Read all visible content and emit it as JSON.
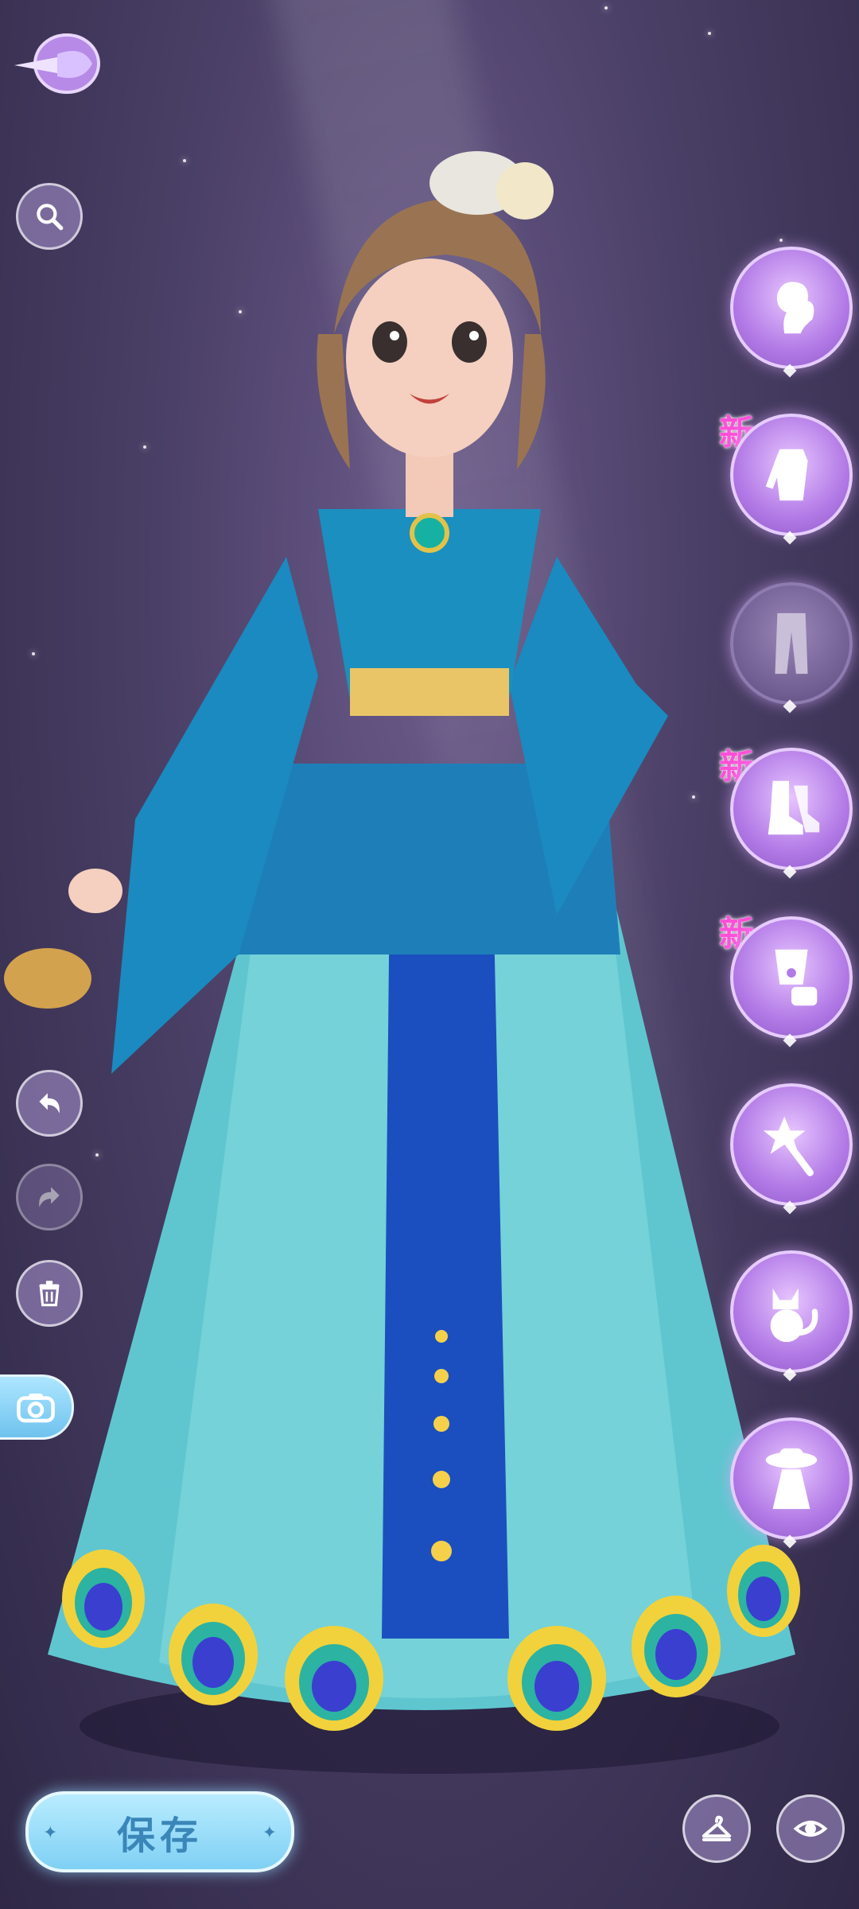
{
  "toolbar": {
    "back_icon": "back-quill-icon",
    "search_icon": "search-icon",
    "undo_icon": "undo-icon",
    "redo_icon": "redo-icon",
    "trash_icon": "trash-icon",
    "camera_icon": "camera-icon"
  },
  "categories": [
    {
      "icon": "hairstyle-icon",
      "new": false,
      "active": true
    },
    {
      "icon": "top-icon",
      "new": true,
      "badge": "新",
      "active": true
    },
    {
      "icon": "bottom-icon",
      "new": false,
      "active": false
    },
    {
      "icon": "shoes-icon",
      "new": true,
      "badge": "新",
      "active": true
    },
    {
      "icon": "accessory-icon",
      "new": true,
      "badge": "新",
      "active": true
    },
    {
      "icon": "magic-wand-icon",
      "new": false,
      "active": true
    },
    {
      "icon": "pet-cat-icon",
      "new": false,
      "active": true
    },
    {
      "icon": "full-outfit-icon",
      "new": false,
      "active": true
    }
  ],
  "bottom": {
    "save_label": "保存",
    "hanger_icon": "hanger-icon",
    "eye_icon": "eye-icon"
  },
  "colors": {
    "accent_purple": "#b27ae6",
    "save_blue": "#7fd0f4",
    "new_badge": "#ff4fd8"
  }
}
